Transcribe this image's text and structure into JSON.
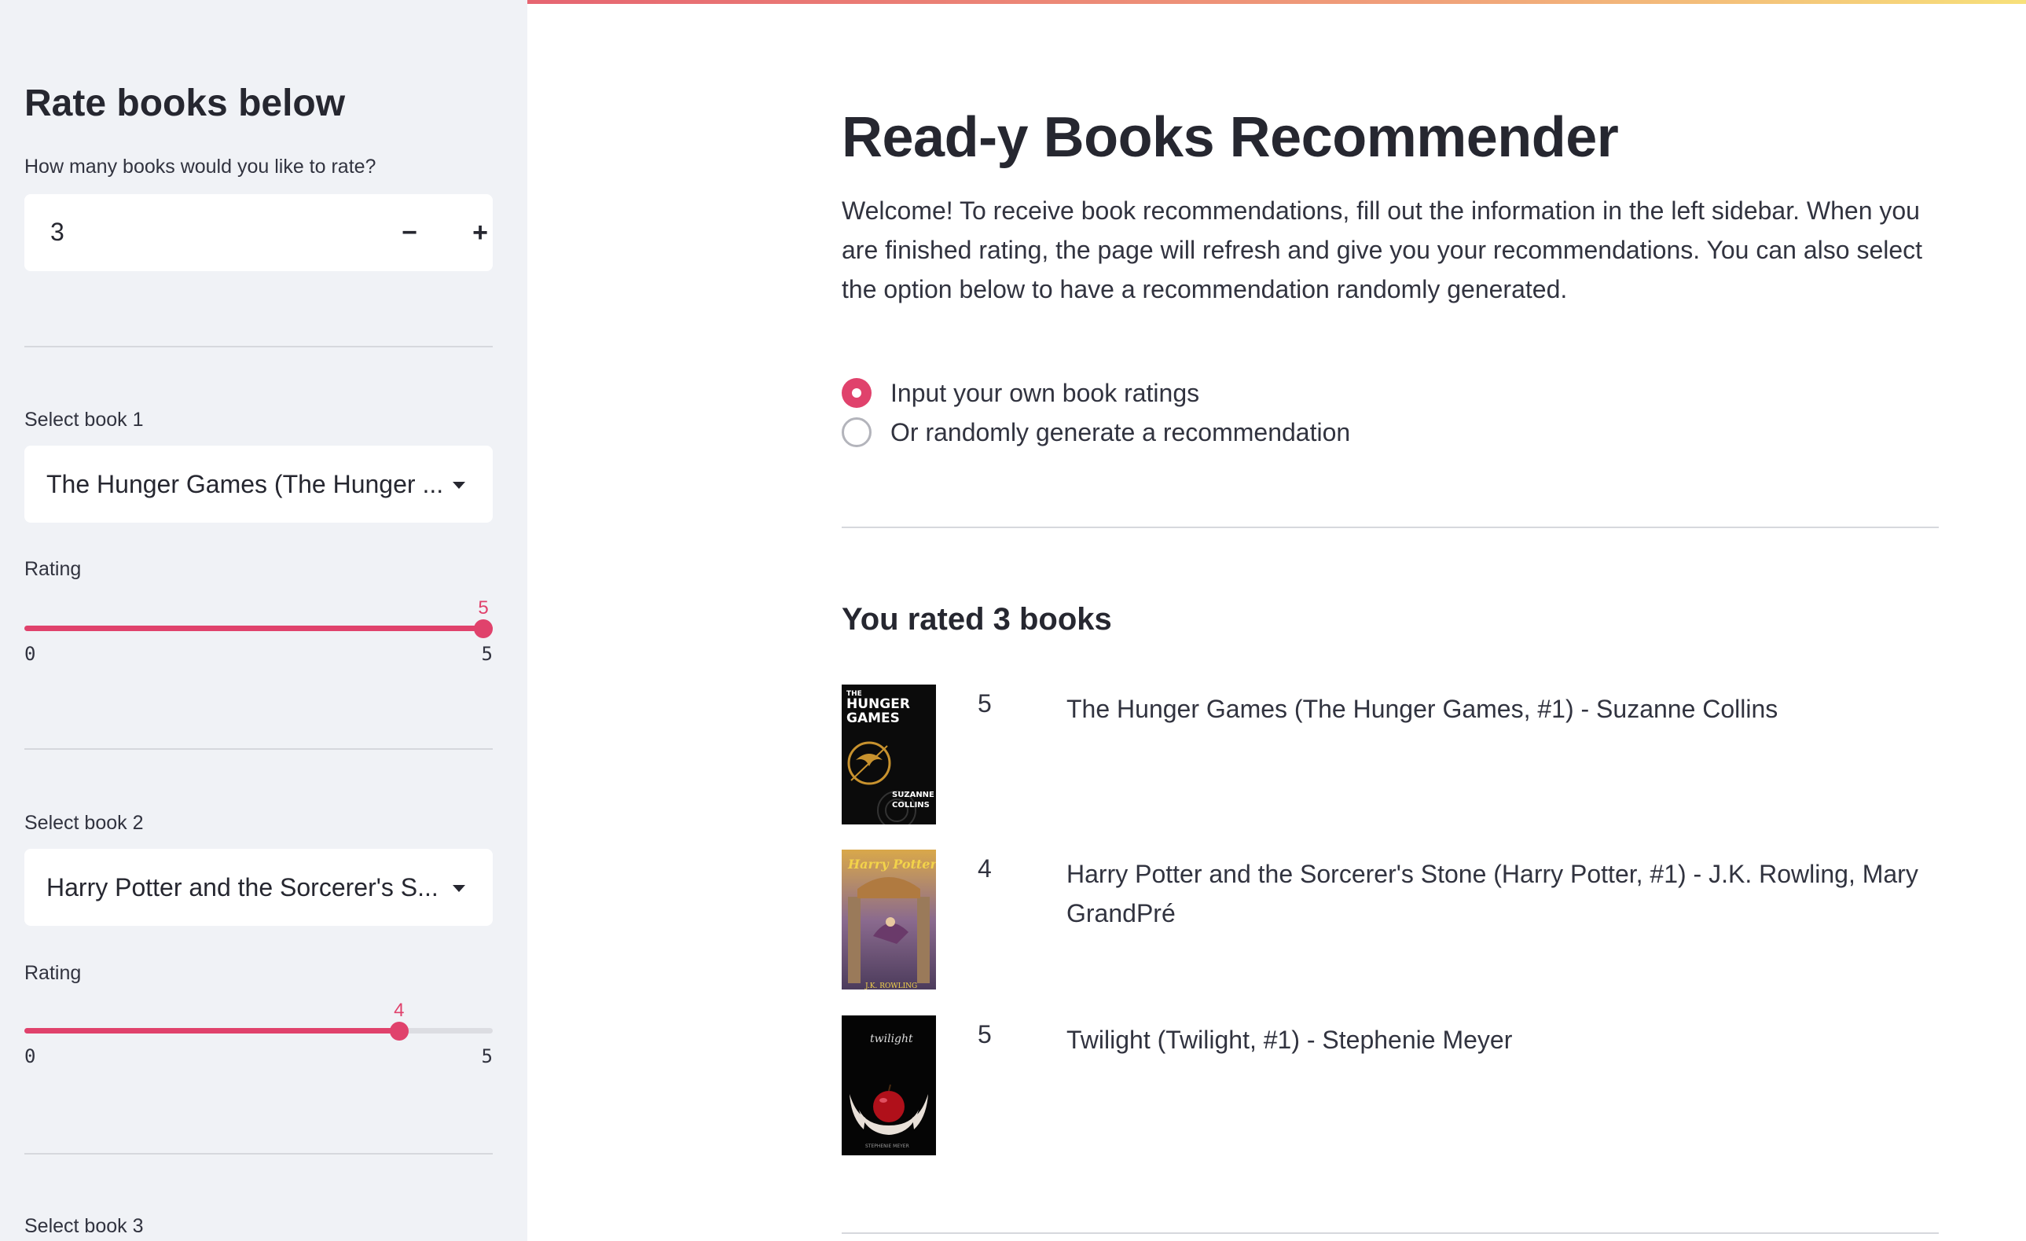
{
  "sidebar": {
    "title": "Rate books below",
    "count_label": "How many books would you like to rate?",
    "count_value": "3",
    "minus": "−",
    "plus": "+",
    "books": [
      {
        "select_label": "Select book 1",
        "selected": "The Hunger Games (The Hunger ...",
        "rating_label": "Rating",
        "rating": 5,
        "rating_text": "5",
        "min": "0",
        "max": "5"
      },
      {
        "select_label": "Select book 2",
        "selected": "Harry Potter and the Sorcerer's S...",
        "rating_label": "Rating",
        "rating": 4,
        "rating_text": "4",
        "min": "0",
        "max": "5"
      },
      {
        "select_label": "Select book 3"
      }
    ]
  },
  "main": {
    "title": "Read-y Books Recommender",
    "intro": "Welcome! To receive book recommendations, fill out the information in the left sidebar. When you are finished rating, the page will refresh and give you your recommendations. You can also select the option below to have a recommendation randomly generated.",
    "radio_options": [
      {
        "label": "Input your own book ratings",
        "checked": true
      },
      {
        "label": "Or randomly generate a recommendation",
        "checked": false
      }
    ],
    "rated_heading": "You rated 3 books",
    "rated_books": [
      {
        "rating": "5",
        "title": "The Hunger Games (The Hunger Games, #1) - Suzanne Collins",
        "cover_text": [
          "THE",
          "HUNGER",
          "GAMES",
          "SUZANNE",
          "COLLINS"
        ]
      },
      {
        "rating": "4",
        "title": "Harry Potter and the Sorcerer's Stone (Harry Potter, #1) - J.K. Rowling, Mary GrandPré",
        "cover_text": [
          "Harry Potter",
          "J.K. ROWLING"
        ]
      },
      {
        "rating": "5",
        "title": "Twilight (Twilight, #1) - Stephenie Meyer",
        "cover_text": [
          "twilight",
          "STEPHENIE MEYER"
        ]
      }
    ]
  },
  "colors": {
    "accent": "#e0426c",
    "sidebar_bg": "#f0f2f6",
    "text": "#262730"
  }
}
